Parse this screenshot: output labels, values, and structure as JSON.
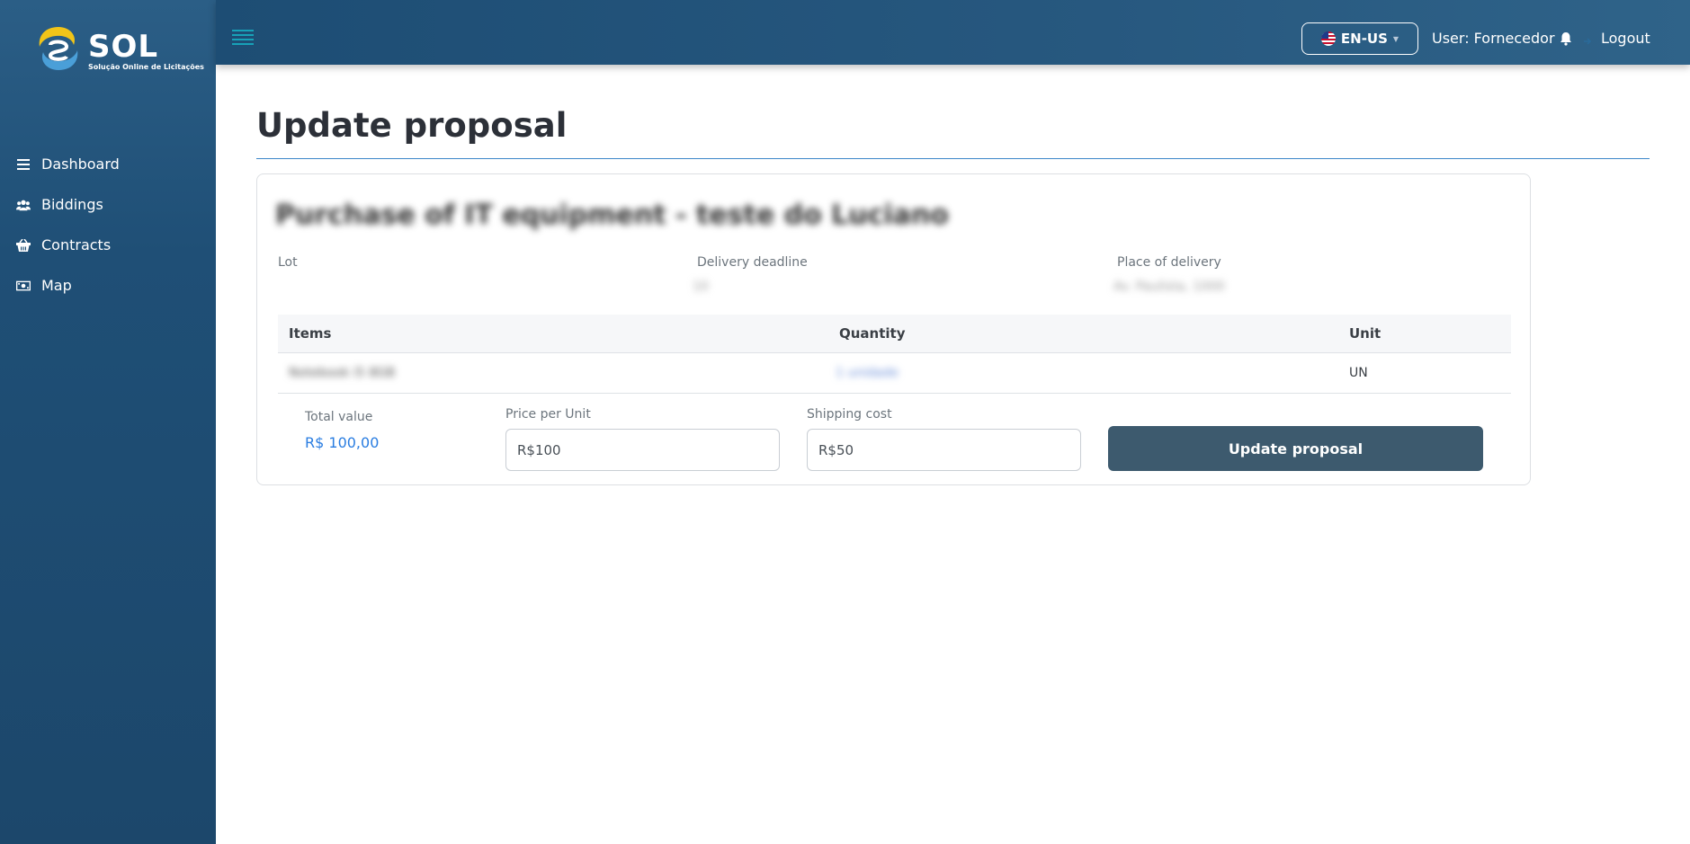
{
  "brand": {
    "name": "SOL",
    "tagline": "Solução Online de Licitações"
  },
  "sidebar": {
    "items": [
      {
        "label": "Dashboard",
        "icon": "list-icon"
      },
      {
        "label": "Biddings",
        "icon": "users-icon"
      },
      {
        "label": "Contracts",
        "icon": "basket-icon"
      },
      {
        "label": "Map",
        "icon": "money-icon"
      }
    ]
  },
  "topbar": {
    "language": "EN-US",
    "user_label": "User: Fornecedor",
    "logout_label": "Logout"
  },
  "page": {
    "title": "Update proposal"
  },
  "proposal": {
    "title": "Purchase of IT equipment - teste do Luciano",
    "lot_label": "Lot",
    "delivery_deadline_label": "Delivery deadline",
    "delivery_deadline_value": "10",
    "place_of_delivery_label": "Place of delivery",
    "place_of_delivery_value": "Av. Paulista, 1000",
    "table": {
      "headers": [
        "Items",
        "Quantity",
        "Unit"
      ],
      "rows": [
        {
          "item": "Notebook i5 8GB",
          "quantity": "1 unidade",
          "unit": "UN"
        }
      ]
    },
    "total_value_label": "Total value",
    "total_value": "R$ 100,00",
    "price_per_unit_label": "Price per Unit",
    "price_per_unit_value": "R$100",
    "shipping_cost_label": "Shipping cost",
    "shipping_cost_value": "R$50",
    "update_button": "Update proposal"
  },
  "colors": {
    "sidebar": "#1f4f76",
    "accent": "#2a7de1",
    "button": "#3d5a6e",
    "hamburger": "#17a2b8"
  }
}
